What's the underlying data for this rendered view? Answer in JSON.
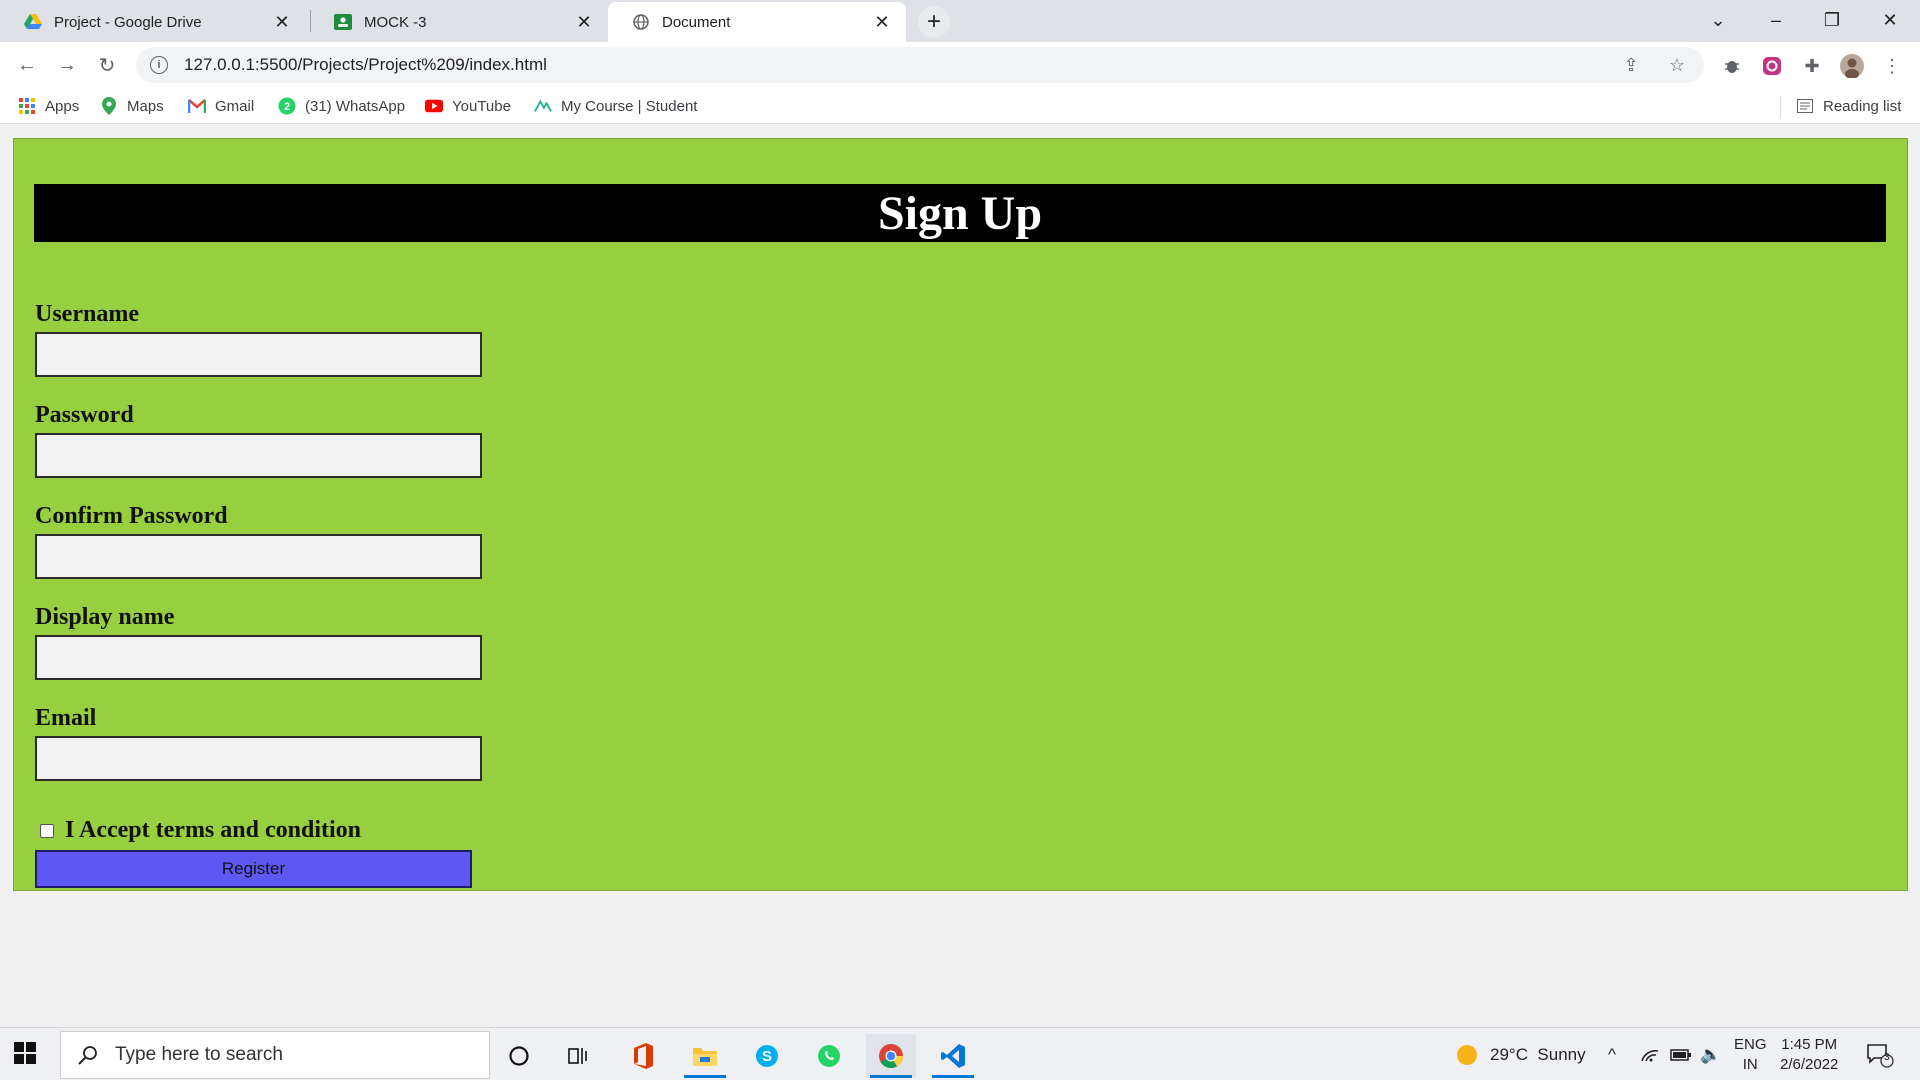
{
  "browser": {
    "tabs": [
      {
        "label": "Project - Google Drive",
        "icon": "google-drive-icon",
        "active": false
      },
      {
        "label": "MOCK -3",
        "icon": "google-classroom-icon",
        "active": false
      },
      {
        "label": "Document",
        "icon": "globe-icon",
        "active": true
      }
    ],
    "url": "127.0.0.1:5500/Projects/Project%209/index.html",
    "bookmarks": [
      {
        "label": "Apps",
        "icon": "apps-grid-icon"
      },
      {
        "label": "Maps",
        "icon": "maps-icon"
      },
      {
        "label": "Gmail",
        "icon": "gmail-icon"
      },
      {
        "label": "(31) WhatsApp",
        "icon": "whatsapp-icon"
      },
      {
        "label": "YouTube",
        "icon": "youtube-icon"
      },
      {
        "label": "My Course | Student",
        "icon": "course-icon"
      }
    ],
    "reading_list": "Reading list"
  },
  "page": {
    "title": "Sign Up",
    "fields": [
      {
        "label": "Username",
        "value": ""
      },
      {
        "label": "Password",
        "value": ""
      },
      {
        "label": "Confirm Password",
        "value": ""
      },
      {
        "label": "Display name",
        "value": ""
      },
      {
        "label": "Email",
        "value": ""
      }
    ],
    "terms_label": "I Accept terms and condition",
    "terms_checked": false,
    "register_label": "Register",
    "colors": {
      "background": "#97cf41",
      "banner": "#000000",
      "button": "#5d58f2"
    }
  },
  "taskbar": {
    "search_placeholder": "Type here to search",
    "weather": "29°C  Sunny",
    "lang_top": "ENG",
    "lang_bottom": "IN",
    "time": "1:45 PM",
    "date": "2/6/2022",
    "notification_count": "3"
  }
}
